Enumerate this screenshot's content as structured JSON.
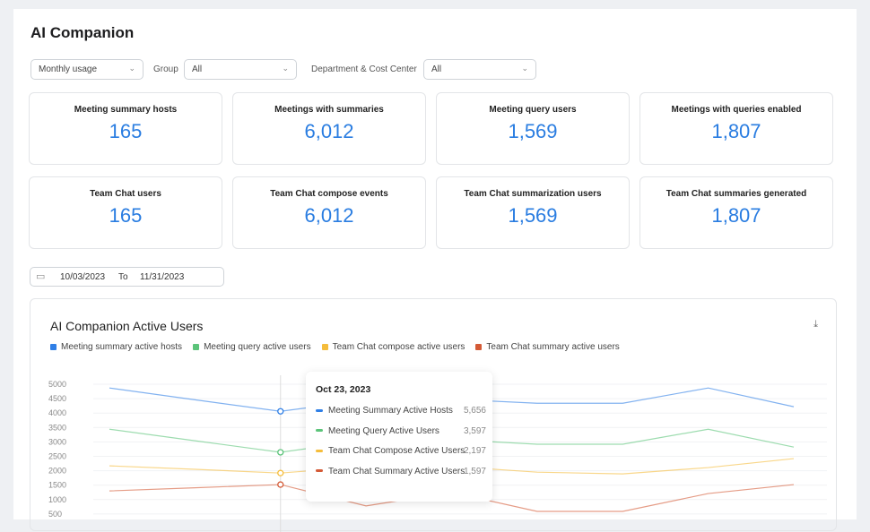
{
  "page": {
    "title": "AI Companion"
  },
  "filters": {
    "period": "Monthly usage",
    "group_label": "Group",
    "group": "All",
    "dept_label": "Department & Cost Center",
    "dept": "All"
  },
  "cards": [
    {
      "label": "Meeting summary hosts",
      "value": "165"
    },
    {
      "label": "Meetings with summaries",
      "value": "6,012"
    },
    {
      "label": "Meeting query users",
      "value": "1,569"
    },
    {
      "label": "Meetings with queries enabled",
      "value": "1,807"
    },
    {
      "label": "Team Chat users",
      "value": "165"
    },
    {
      "label": "Team Chat compose events",
      "value": "6,012"
    },
    {
      "label": "Team Chat summarization users",
      "value": "1,569"
    },
    {
      "label": "Team Chat summaries generated",
      "value": "1,807"
    }
  ],
  "date_range": {
    "from": "10/03/2023",
    "to_label": "To",
    "to": "11/31/2023"
  },
  "icons": {
    "calendar": "calendar-icon",
    "download": "download-icon",
    "chevron": "chevron-down-icon"
  },
  "chart_data": {
    "type": "line",
    "title": "AI Companion Active Users",
    "ylim": [
      0,
      5000
    ],
    "yticks": [
      500,
      1000,
      1500,
      2000,
      2500,
      3000,
      3500,
      4000,
      4500,
      5000
    ],
    "grid": true,
    "legend_placement": "top-left",
    "hover_index": 2,
    "series": [
      {
        "name": "Meeting summary active hosts",
        "color": "#2f7fe6",
        "values": [
          4870,
          4460,
          4060,
          4450,
          4480,
          4340,
          4340,
          4870,
          4220
        ]
      },
      {
        "name": "Meeting query active users",
        "color": "#5cc47a",
        "values": [
          3440,
          3040,
          2640,
          3050,
          3080,
          2920,
          2920,
          3440,
          2820
        ]
      },
      {
        "name": "Team Chat compose active users",
        "color": "#f5bd3c",
        "values": [
          2170,
          2050,
          1920,
          2150,
          2150,
          1950,
          1890,
          2110,
          2420
        ]
      },
      {
        "name": "Team Chat summary active users",
        "color": "#d45a36",
        "values": [
          1300,
          1410,
          1520,
          780,
          1250,
          590,
          590,
          1210,
          1520
        ]
      }
    ],
    "tooltip": {
      "date": "Oct 23, 2023",
      "rows": [
        {
          "label": "Meeting Summary Active Hosts",
          "value": "5,656"
        },
        {
          "label": "Meeting Query Active Users",
          "value": "3,597"
        },
        {
          "label": "Team Chat Compose Active Users",
          "value": "2,197"
        },
        {
          "label": "Team Chat Summary Active Users",
          "value": "1,597"
        }
      ]
    }
  }
}
